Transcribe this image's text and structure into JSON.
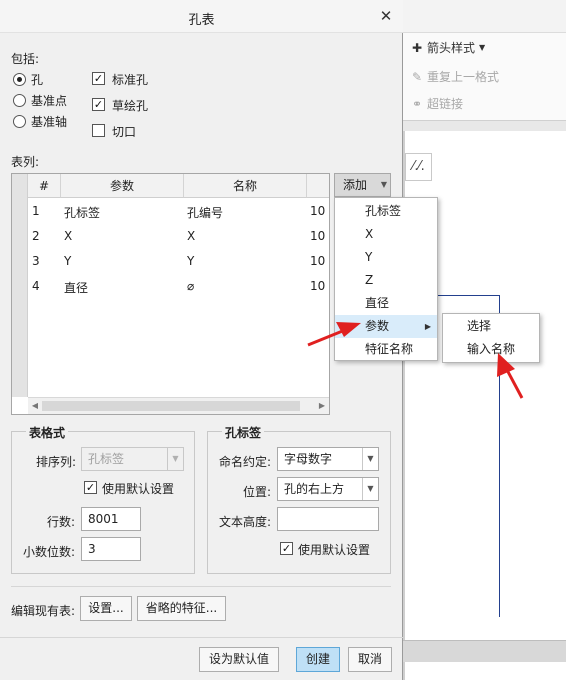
{
  "background": {
    "ribbon": {
      "arrow_style": "箭头样式",
      "repeat_format": "重复上一格式",
      "hyperlink": "超链接"
    },
    "tool_icon": "⁄.⁄."
  },
  "dialog": {
    "title": "孔表",
    "include_label": "包括:",
    "radios": [
      "孔",
      "基准点",
      "基准轴"
    ],
    "checks": [
      "标准孔",
      "草绘孔",
      "切口"
    ],
    "table_label": "表列:",
    "table": {
      "headers": [
        "#",
        "参数",
        "名称"
      ],
      "rows": [
        {
          "num": "1",
          "param": "孔标签",
          "name": "孔编号",
          "extra": "10"
        },
        {
          "num": "2",
          "param": "X",
          "name": "X",
          "extra": "10"
        },
        {
          "num": "3",
          "param": "Y",
          "name": "Y",
          "extra": "10"
        },
        {
          "num": "4",
          "param": "直径",
          "name": "⌀",
          "extra": "10"
        }
      ]
    },
    "add_button": "添加",
    "add_menu": [
      "孔标签",
      "X",
      "Y",
      "Z",
      "直径",
      "参数",
      "特征名称"
    ],
    "param_submenu": [
      "选择",
      "输入名称"
    ],
    "table_format": {
      "title": "表格式",
      "sort_label": "排序列:",
      "sort_value": "孔标签",
      "use_default": "使用默认设置",
      "rows_label": "行数:",
      "rows_value": "8001",
      "decimals_label": "小数位数:",
      "decimals_value": "3"
    },
    "hole_tag": {
      "title": "孔标签",
      "naming_label": "命名约定:",
      "naming_value": "字母数字",
      "position_label": "位置:",
      "position_value": "孔的右上方",
      "text_height_label": "文本高度:",
      "text_height_value": "",
      "use_default": "使用默认设置"
    },
    "edit_label": "编辑现有表:",
    "settings_button": "设置...",
    "omitted_button": "省略的特征...",
    "set_default_button": "设为默认值",
    "create_button": "创建",
    "cancel_button": "取消"
  },
  "colors": {
    "accent": "#5ea7d8",
    "highlight": "#d9ecfa",
    "annotation_arrow": "#e02020",
    "drawing_line": "#23408e"
  }
}
